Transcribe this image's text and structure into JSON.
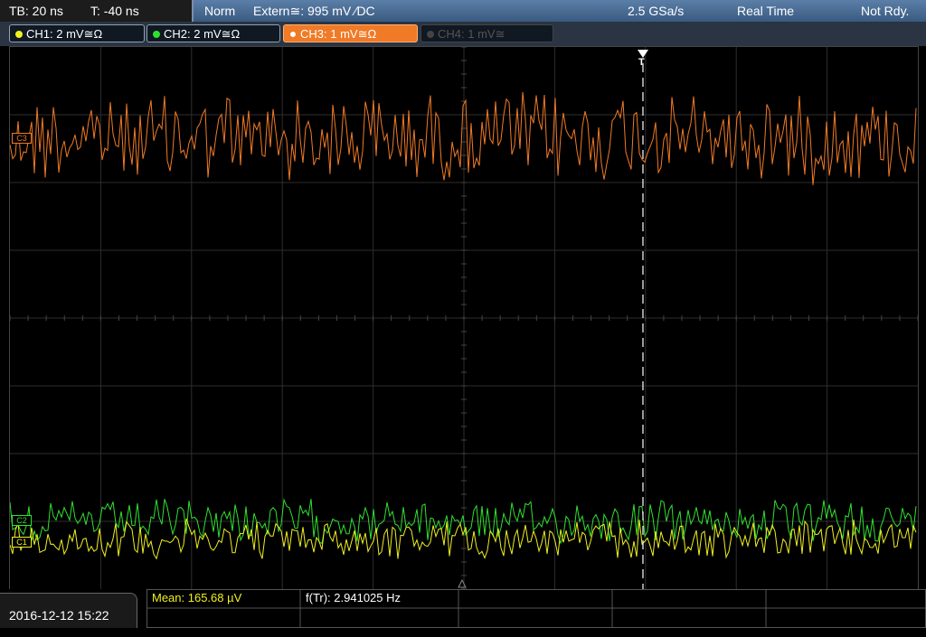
{
  "timebase": {
    "tb": "TB: 20 ns",
    "trigger_time": "T: -40 ns"
  },
  "acquisition": {
    "mode": "Norm",
    "trigger_source": "Extern≅: 995 mV ∕DC",
    "sample_rate": "2.5 GSa/s",
    "realtime": "Real Time",
    "status": "Not Rdy."
  },
  "channels": [
    {
      "label": "CH1: 2 mV≅Ω",
      "color": "#f0f020"
    },
    {
      "label": "CH2: 2 mV≅Ω",
      "color": "#30e030"
    },
    {
      "label": "CH3: 1 mV≅Ω",
      "color": "#f07a26"
    },
    {
      "label": "CH4: 1 mV≅",
      "color": "#555555"
    }
  ],
  "markers": {
    "ch3": "C3",
    "ch2": "C2",
    "ch1": "C1",
    "trigger": "T"
  },
  "footer": {
    "datetime": "2016-12-12 15:22",
    "mean": "Mean: 165.68 µV",
    "freq": "f(Tr): 2.941025 Hz"
  },
  "colors": {
    "ch1": "#f0f020",
    "ch2": "#30e030",
    "ch3": "#f07a26",
    "grid": "#2e2e2e"
  }
}
